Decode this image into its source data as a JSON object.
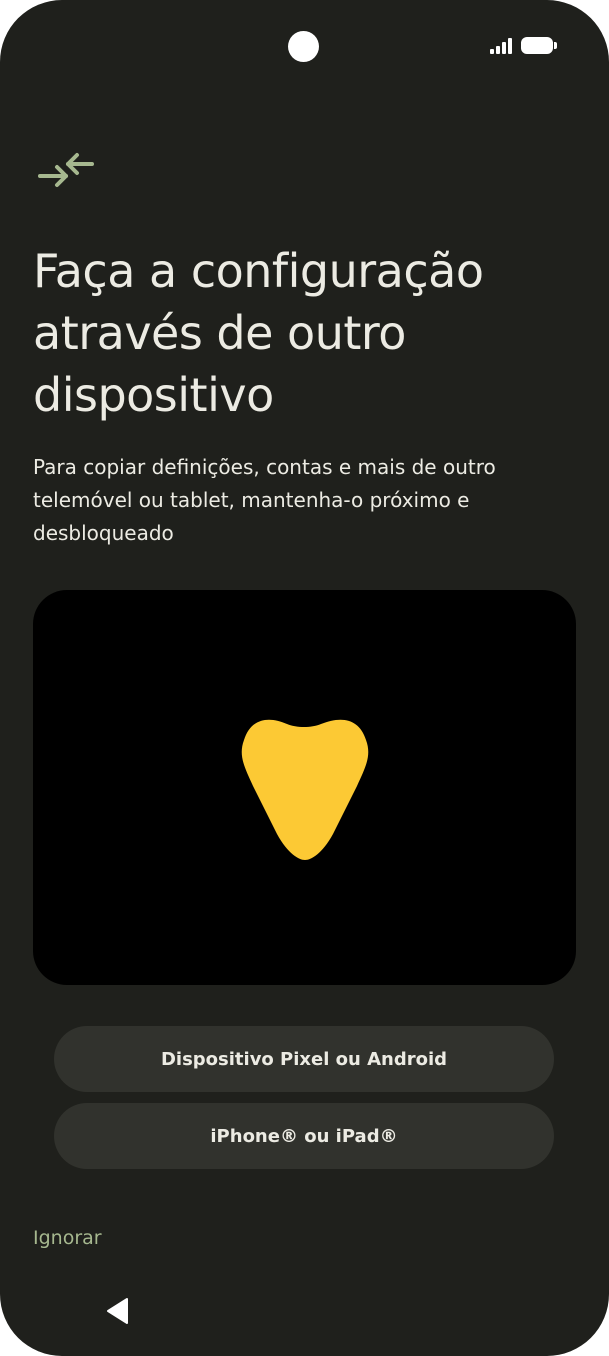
{
  "screen": {
    "title": "Faça a configuração através de outro dispositivo",
    "description": "Para copiar definições, contas e mais de outro telemóvel ou tablet, mantenha-o próximo e desbloqueado"
  },
  "options": {
    "android_label": "Dispositivo Pixel ou Android",
    "iphone_label": "iPhone® ou iPad®"
  },
  "footer": {
    "skip_label": "Ignorar"
  },
  "icons": {
    "header": "swap-arrows-icon",
    "illustration": "heart-shape",
    "nav": "back-triangle-icon"
  },
  "colors": {
    "background": "#1f201c",
    "accent_green": "#a6b88f",
    "illustration_yellow": "#fcc934",
    "button_bg": "#31322d"
  }
}
